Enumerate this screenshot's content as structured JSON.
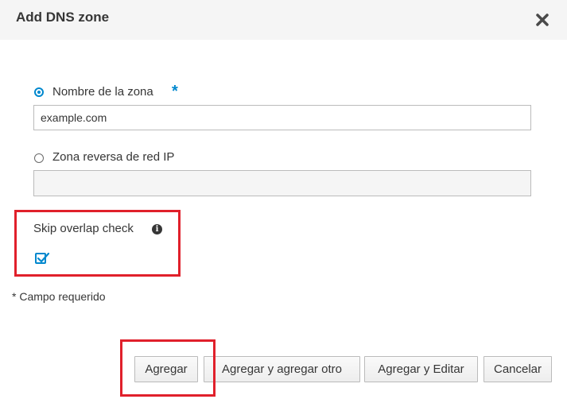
{
  "dialog": {
    "title": "Add DNS zone",
    "close_icon": "close-icon"
  },
  "form": {
    "zone_name_label": "Nombre de la zona",
    "required_marker": "*",
    "zone_name_value": "example.com",
    "zone_name_selected": true,
    "reverse_zone_label": "Zona reversa de red IP",
    "reverse_zone_value": "",
    "reverse_zone_selected": false,
    "skip_overlap_label": "Skip overlap check",
    "skip_overlap_info_icon": "info-icon",
    "skip_overlap_checked": true,
    "required_note": "* Campo requerido"
  },
  "buttons": {
    "add": "Agregar",
    "add_and_add_another": "Agregar y agregar otro",
    "add_and_edit": "Agregar y Editar",
    "cancel": "Cancelar"
  },
  "colors": {
    "accent": "#0088ce",
    "highlight": "#e0202b",
    "header_bg": "#f5f5f5"
  }
}
